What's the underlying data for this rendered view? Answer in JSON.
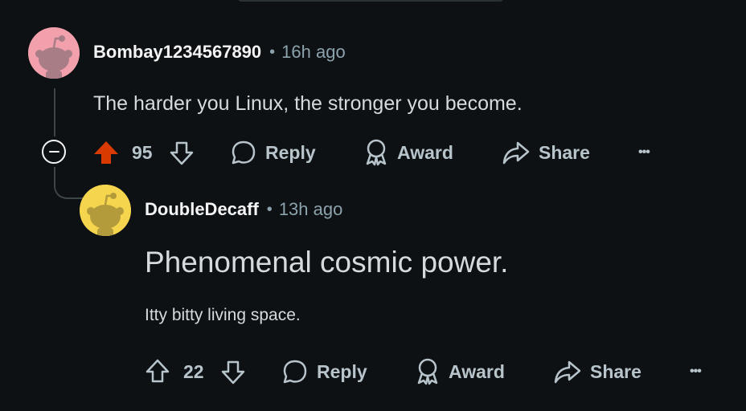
{
  "comments": [
    {
      "username": "Bombay1234567890",
      "separator": "•",
      "time": "16h ago",
      "body": "The harder you Linux, the stronger you become.",
      "votes": "95",
      "upvoted": true,
      "avatar_bg": "#f1a0ac",
      "actions": {
        "reply": "Reply",
        "award": "Award",
        "share": "Share",
        "more": "•••"
      }
    },
    {
      "username": "DoubleDecaff",
      "separator": "•",
      "time": "13h ago",
      "heading": "Phenomenal cosmic power.",
      "body": "Itty bitty living space.",
      "votes": "22",
      "upvoted": false,
      "avatar_bg": "#f5d44e",
      "actions": {
        "reply": "Reply",
        "award": "Award",
        "share": "Share",
        "more": "•••"
      }
    }
  ],
  "colors": {
    "background": "#0e1113",
    "upvote_active": "#d93a00",
    "meta_text": "#8ba2ad",
    "action_text": "#b7c4cb"
  }
}
